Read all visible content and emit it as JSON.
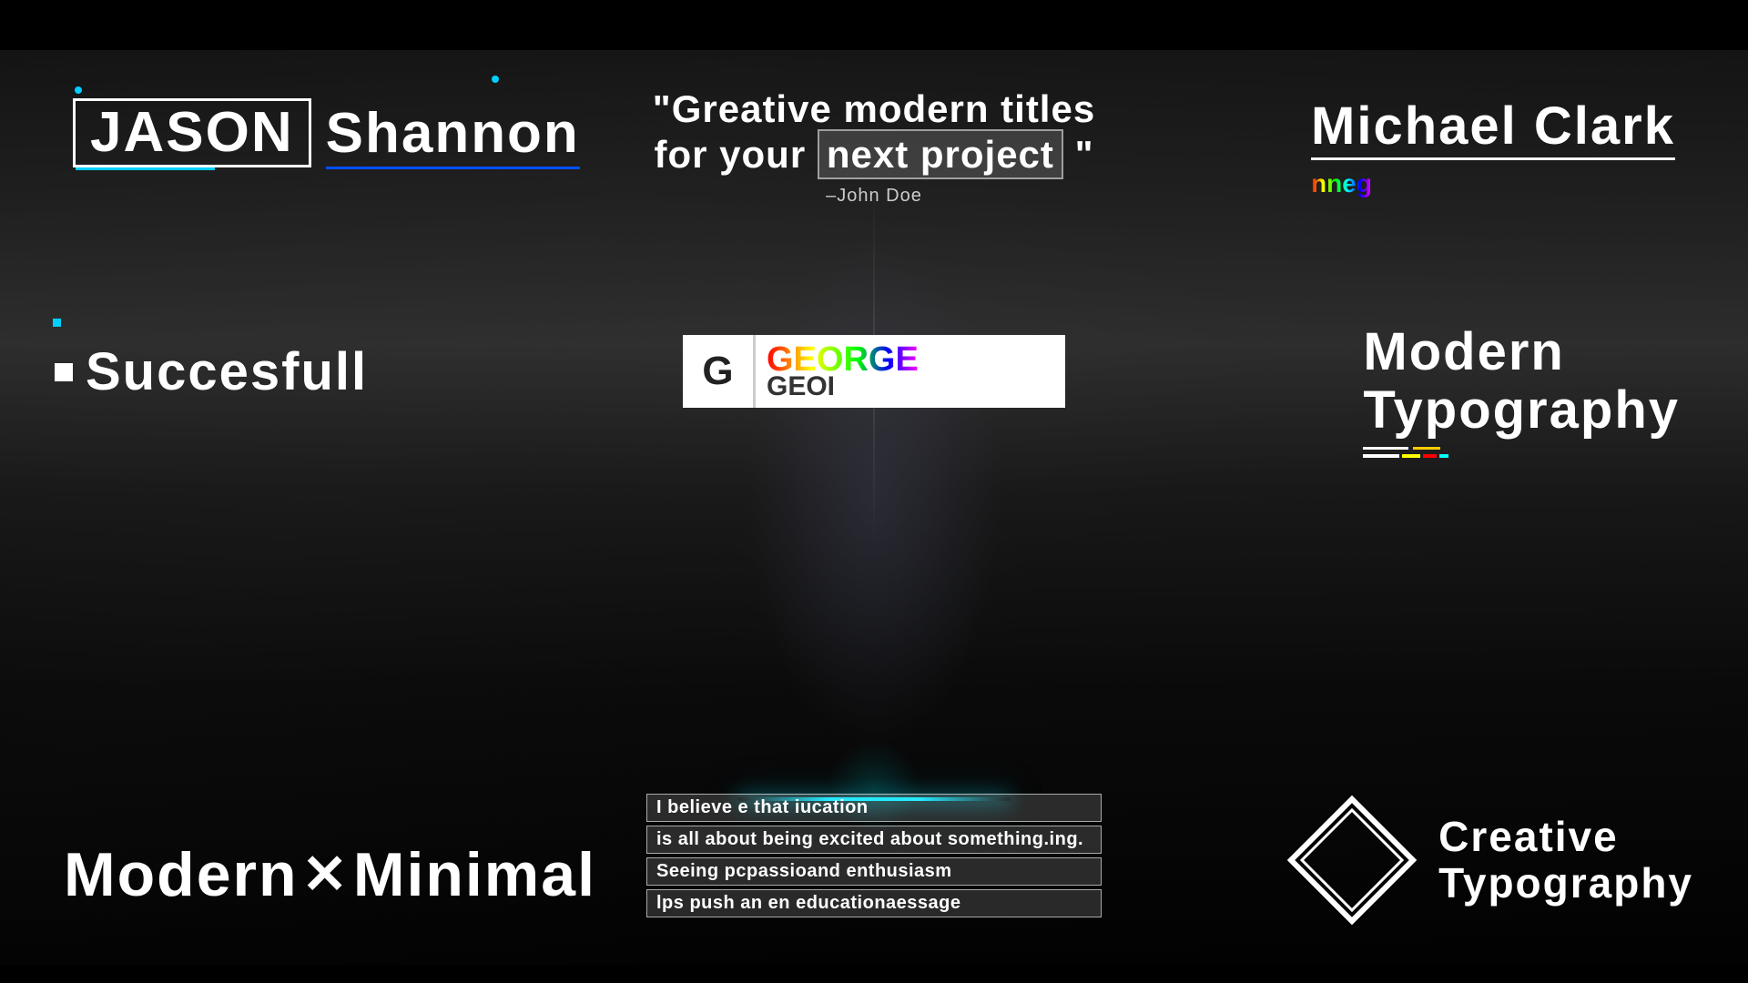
{
  "header": {
    "letterbox_top": true,
    "letterbox_bottom": true
  },
  "elements": {
    "jason_shannon": {
      "jason_label": "Jason",
      "shannon_label": "Shannon"
    },
    "quote_center": {
      "line1": "\"Greative modern titles",
      "line2": "for your",
      "next_project": "next project",
      "line2_end": "\"",
      "attribution": "–John Doe"
    },
    "michael_clark": {
      "name": "Michael Clark",
      "sub": "nneg"
    },
    "successful": {
      "label": "Succesfull"
    },
    "george": {
      "letter": "G",
      "top": "GEORGE",
      "bottom": "GEOI"
    },
    "modern_typography": {
      "line1": "Modern",
      "line2": "Typography"
    },
    "modern_minimal": {
      "part1": "Modern",
      "x": "✕",
      "part2": "Minimal"
    },
    "quote_block": {
      "line1": "I believe e that iucation",
      "line2": "is all about being excited about something.ing.",
      "line3": "Seeing pcpassioand enthusiasm",
      "line4": "lps push an en educationaessage"
    },
    "creative_typography": {
      "line1": "Creative",
      "line2": "Typography"
    }
  }
}
